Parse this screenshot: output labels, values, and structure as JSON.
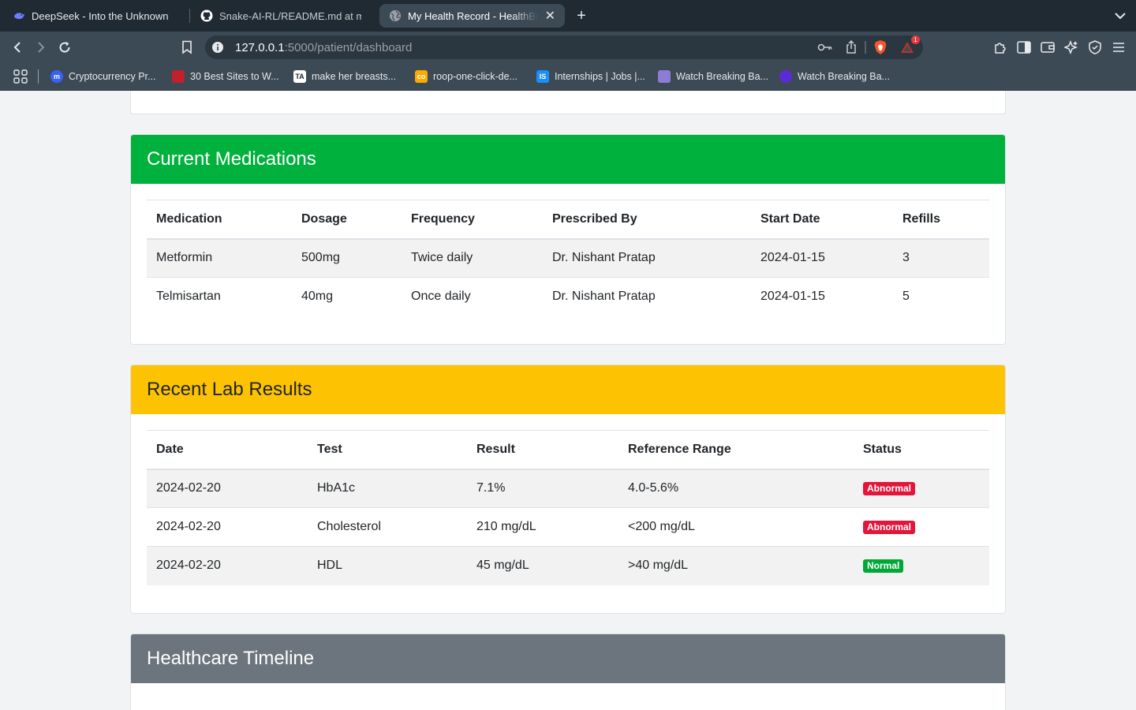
{
  "browser": {
    "tabs": [
      {
        "title": "DeepSeek - Into the Unknown",
        "icon": "deepseek-whale-icon",
        "active": false
      },
      {
        "title": "Snake-AI-RL/README.md at main",
        "icon": "github-icon",
        "active": false
      },
      {
        "title": "My Health Record - HealthBridge",
        "icon": "globe-icon",
        "active": true
      }
    ],
    "new_tab_label": "+",
    "address": {
      "host": "127.0.0.1",
      "path": ":5000/patient/dashboard"
    },
    "notification_count": "1",
    "bookmarks": [
      {
        "label": "Cryptocurrency Pr...",
        "icon": "coinmarketcap-icon",
        "color": "#3861fb",
        "glyph": "m"
      },
      {
        "label": "30 Best Sites to W...",
        "icon": "bookmark-site-icon",
        "color": "#c0212d",
        "glyph": ""
      },
      {
        "label": "make her breasts...",
        "icon": "ta-icon",
        "color": "#ffffff",
        "glyph": "TA"
      },
      {
        "label": "roop-one-click-de...",
        "icon": "colab-icon",
        "color": "#f9ab00",
        "glyph": "co"
      },
      {
        "label": "Internships | Jobs |...",
        "icon": "internshala-icon",
        "color": "#1a8ffc",
        "glyph": "IS"
      },
      {
        "label": "Watch Breaking Ba...",
        "icon": "film-icon",
        "color": "#8e7bd6",
        "glyph": ""
      },
      {
        "label": "Watch Breaking Ba...",
        "icon": "play-icon",
        "color": "#5b2bd8",
        "glyph": ""
      }
    ]
  },
  "medications": {
    "title": "Current Medications",
    "header_color": "#00b13d",
    "columns": [
      "Medication",
      "Dosage",
      "Frequency",
      "Prescribed By",
      "Start Date",
      "Refills"
    ],
    "rows": [
      [
        "Metformin",
        "500mg",
        "Twice daily",
        "Dr. Nishant Pratap",
        "2024-01-15",
        "3"
      ],
      [
        "Telmisartan",
        "40mg",
        "Once daily",
        "Dr. Nishant Pratap",
        "2024-01-15",
        "5"
      ]
    ]
  },
  "labs": {
    "title": "Recent Lab Results",
    "header_color": "#fdc302",
    "columns": [
      "Date",
      "Test",
      "Result",
      "Reference Range",
      "Status"
    ],
    "rows": [
      {
        "date": "2024-02-20",
        "test": "HbA1c",
        "result": "7.1%",
        "range": "4.0-5.6%",
        "status": "Abnormal",
        "status_color": "#e1163a"
      },
      {
        "date": "2024-02-20",
        "test": "Cholesterol",
        "result": "210 mg/dL",
        "range": "<200 mg/dL",
        "status": "Abnormal",
        "status_color": "#e1163a"
      },
      {
        "date": "2024-02-20",
        "test": "HDL",
        "result": "45 mg/dL",
        "range": ">40 mg/dL",
        "status": "Normal",
        "status_color": "#00a838"
      }
    ]
  },
  "timeline": {
    "title": "Healthcare Timeline",
    "header_color": "#6c757d"
  }
}
